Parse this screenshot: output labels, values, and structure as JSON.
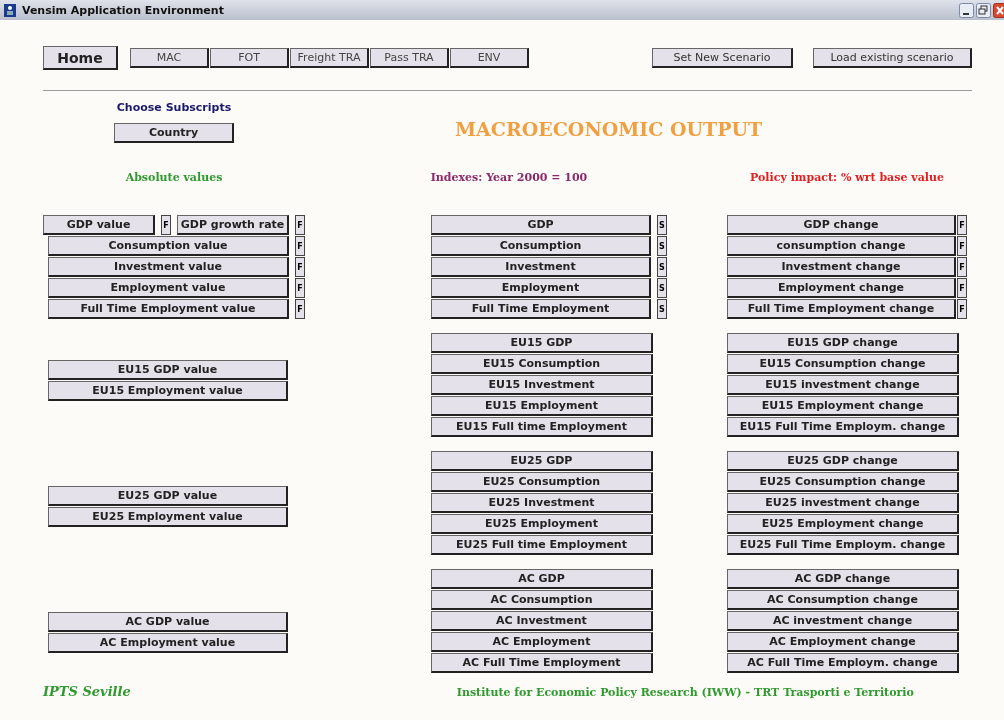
{
  "window": {
    "title": "Vensim Application Environment"
  },
  "toolbar": {
    "home": "Home",
    "tabs": [
      "MAC",
      "FOT",
      "Freight TRA",
      "Pass TRA",
      "ENV"
    ],
    "actions": [
      "Set New Scenario",
      "Load existing scenario"
    ]
  },
  "subscripts": {
    "label": "Choose Subscripts",
    "button": "Country"
  },
  "page_title": "MACROECONOMIC OUTPUT",
  "columns": [
    {
      "heading": "Absolute values",
      "color": "#2e9a2e",
      "groups": [
        [
          [
            {
              "kind": "button",
              "label": "GDP value"
            },
            {
              "kind": "flag",
              "label": "F"
            },
            {
              "kind": "button",
              "label": "GDP growth rate"
            },
            {
              "kind": "flag",
              "label": "F"
            }
          ],
          [
            {
              "kind": "button",
              "label": "Consumption value"
            },
            {
              "kind": "flag",
              "label": "F"
            }
          ],
          [
            {
              "kind": "button",
              "label": "Investment value"
            },
            {
              "kind": "flag",
              "label": "F"
            }
          ],
          [
            {
              "kind": "button",
              "label": "Employment value"
            },
            {
              "kind": "flag",
              "label": "F"
            }
          ],
          [
            {
              "kind": "button",
              "label": "Full Time Employment value"
            },
            {
              "kind": "flag",
              "label": "F"
            }
          ]
        ],
        [
          [
            {
              "kind": "button",
              "label": "EU15 GDP value"
            }
          ],
          [
            {
              "kind": "button",
              "label": "EU15 Employment value"
            }
          ]
        ],
        [
          [
            {
              "kind": "button",
              "label": "EU25 GDP value"
            }
          ],
          [
            {
              "kind": "button",
              "label": "EU25 Employment value"
            }
          ]
        ],
        [
          [
            {
              "kind": "button",
              "label": "AC GDP value"
            }
          ],
          [
            {
              "kind": "button",
              "label": "AC Employment value"
            }
          ]
        ]
      ]
    },
    {
      "heading": "Indexes: Year 2000 = 100",
      "color": "#8a2a6a",
      "groups": [
        [
          [
            {
              "kind": "button",
              "label": "GDP"
            },
            {
              "kind": "flag",
              "label": "S"
            }
          ],
          [
            {
              "kind": "button",
              "label": "Consumption"
            },
            {
              "kind": "flag",
              "label": "S"
            }
          ],
          [
            {
              "kind": "button",
              "label": "Investment"
            },
            {
              "kind": "flag",
              "label": "S"
            }
          ],
          [
            {
              "kind": "button",
              "label": "Employment"
            },
            {
              "kind": "flag",
              "label": "S"
            }
          ],
          [
            {
              "kind": "button",
              "label": "Full Time Employment"
            },
            {
              "kind": "flag",
              "label": "S"
            }
          ]
        ],
        [
          [
            {
              "kind": "button",
              "label": "EU15 GDP"
            }
          ],
          [
            {
              "kind": "button",
              "label": "EU15 Consumption"
            }
          ],
          [
            {
              "kind": "button",
              "label": "EU15 Investment"
            }
          ],
          [
            {
              "kind": "button",
              "label": "EU15 Employment"
            }
          ],
          [
            {
              "kind": "button",
              "label": "EU15 Full time Employment"
            }
          ]
        ],
        [
          [
            {
              "kind": "button",
              "label": "EU25 GDP"
            }
          ],
          [
            {
              "kind": "button",
              "label": "EU25 Consumption"
            }
          ],
          [
            {
              "kind": "button",
              "label": "EU25 Investment"
            }
          ],
          [
            {
              "kind": "button",
              "label": "EU25 Employment"
            }
          ],
          [
            {
              "kind": "button",
              "label": "EU25 Full time Employment"
            }
          ]
        ],
        [
          [
            {
              "kind": "button",
              "label": "AC GDP"
            }
          ],
          [
            {
              "kind": "button",
              "label": "AC Consumption"
            }
          ],
          [
            {
              "kind": "button",
              "label": "AC Investment"
            }
          ],
          [
            {
              "kind": "button",
              "label": "AC Employment"
            }
          ],
          [
            {
              "kind": "button",
              "label": "AC Full Time Employment"
            }
          ]
        ]
      ]
    },
    {
      "heading": "Policy impact: % wrt base value",
      "color": "#e02020",
      "groups": [
        [
          [
            {
              "kind": "button",
              "label": "GDP change"
            },
            {
              "kind": "flag",
              "label": "F"
            }
          ],
          [
            {
              "kind": "button",
              "label": "consumption change"
            },
            {
              "kind": "flag",
              "label": "F"
            }
          ],
          [
            {
              "kind": "button",
              "label": "Investment change"
            },
            {
              "kind": "flag",
              "label": "F"
            }
          ],
          [
            {
              "kind": "button",
              "label": "Employment change"
            },
            {
              "kind": "flag",
              "label": "F"
            }
          ],
          [
            {
              "kind": "button",
              "label": "Full Time Employment change"
            },
            {
              "kind": "flag",
              "label": "F"
            }
          ]
        ],
        [
          [
            {
              "kind": "button",
              "label": "EU15 GDP change"
            }
          ],
          [
            {
              "kind": "button",
              "label": "EU15 Consumption change"
            }
          ],
          [
            {
              "kind": "button",
              "label": "EU15 investment change"
            }
          ],
          [
            {
              "kind": "button",
              "label": "EU15 Employment change"
            }
          ],
          [
            {
              "kind": "button",
              "label": "EU15 Full Time Employm. change"
            }
          ]
        ],
        [
          [
            {
              "kind": "button",
              "label": "EU25 GDP change"
            }
          ],
          [
            {
              "kind": "button",
              "label": "EU25 Consumption change"
            }
          ],
          [
            {
              "kind": "button",
              "label": "EU25 investment change"
            }
          ],
          [
            {
              "kind": "button",
              "label": "EU25 Employment change"
            }
          ],
          [
            {
              "kind": "button",
              "label": "EU25 Full Time Employm. change"
            }
          ]
        ],
        [
          [
            {
              "kind": "button",
              "label": "AC GDP change"
            }
          ],
          [
            {
              "kind": "button",
              "label": "AC Consumption change"
            }
          ],
          [
            {
              "kind": "button",
              "label": "AC investment change"
            }
          ],
          [
            {
              "kind": "button",
              "label": "AC Employment change"
            }
          ],
          [
            {
              "kind": "button",
              "label": "AC Full Time Employm. change"
            }
          ]
        ]
      ]
    }
  ],
  "footer": {
    "left": "IPTS Seville",
    "right": "Institute for Economic Policy Research (IWW) - TRT Trasporti e Territorio"
  }
}
